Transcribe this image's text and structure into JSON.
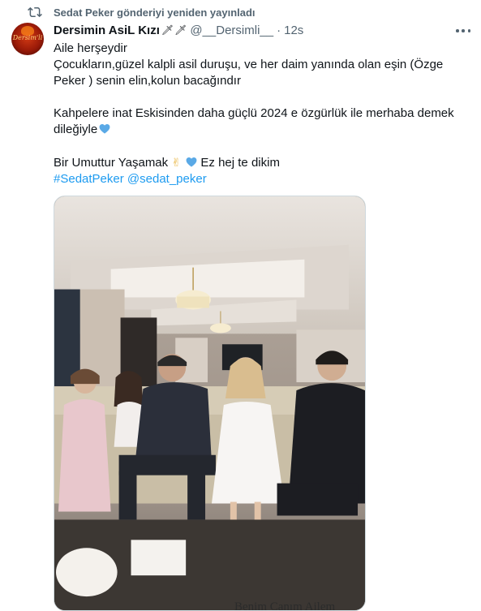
{
  "repost": {
    "label": "Sedat Peker gönderiyi yeniden yayınladı",
    "icon": "repost-icon"
  },
  "author": {
    "avatar_text": "Dersim'li",
    "display_name": "Dersimin AsiL Kızı",
    "badges": "🗡🗡",
    "handle": "@__Dersimli__",
    "separator": "·",
    "time": "12s"
  },
  "post": {
    "lines": [
      "Aile herşeydir",
      "Çocukların,güzel kalpli asil duruşu, ve her daim yanında olan eşin (Özge",
      "Peker ) senin elin,kolun bacağındır",
      "",
      "Kahpelere inat Eskisinden daha güçlü 2024 e özgürlük ile merhaba demek",
      "dileğiyle",
      "",
      "Bir Umuttur Yaşamak",
      "Ez hej te dikim"
    ],
    "hashtag": "#SedatPeker",
    "mention": "@sedat_peker"
  },
  "media": {
    "alt": "photo",
    "caption": "Benim Canım Ailem"
  },
  "colors": {
    "text": "#0f1419",
    "secondary": "#536471",
    "link": "#1d9bf0",
    "heart": "#5aa9e6"
  }
}
